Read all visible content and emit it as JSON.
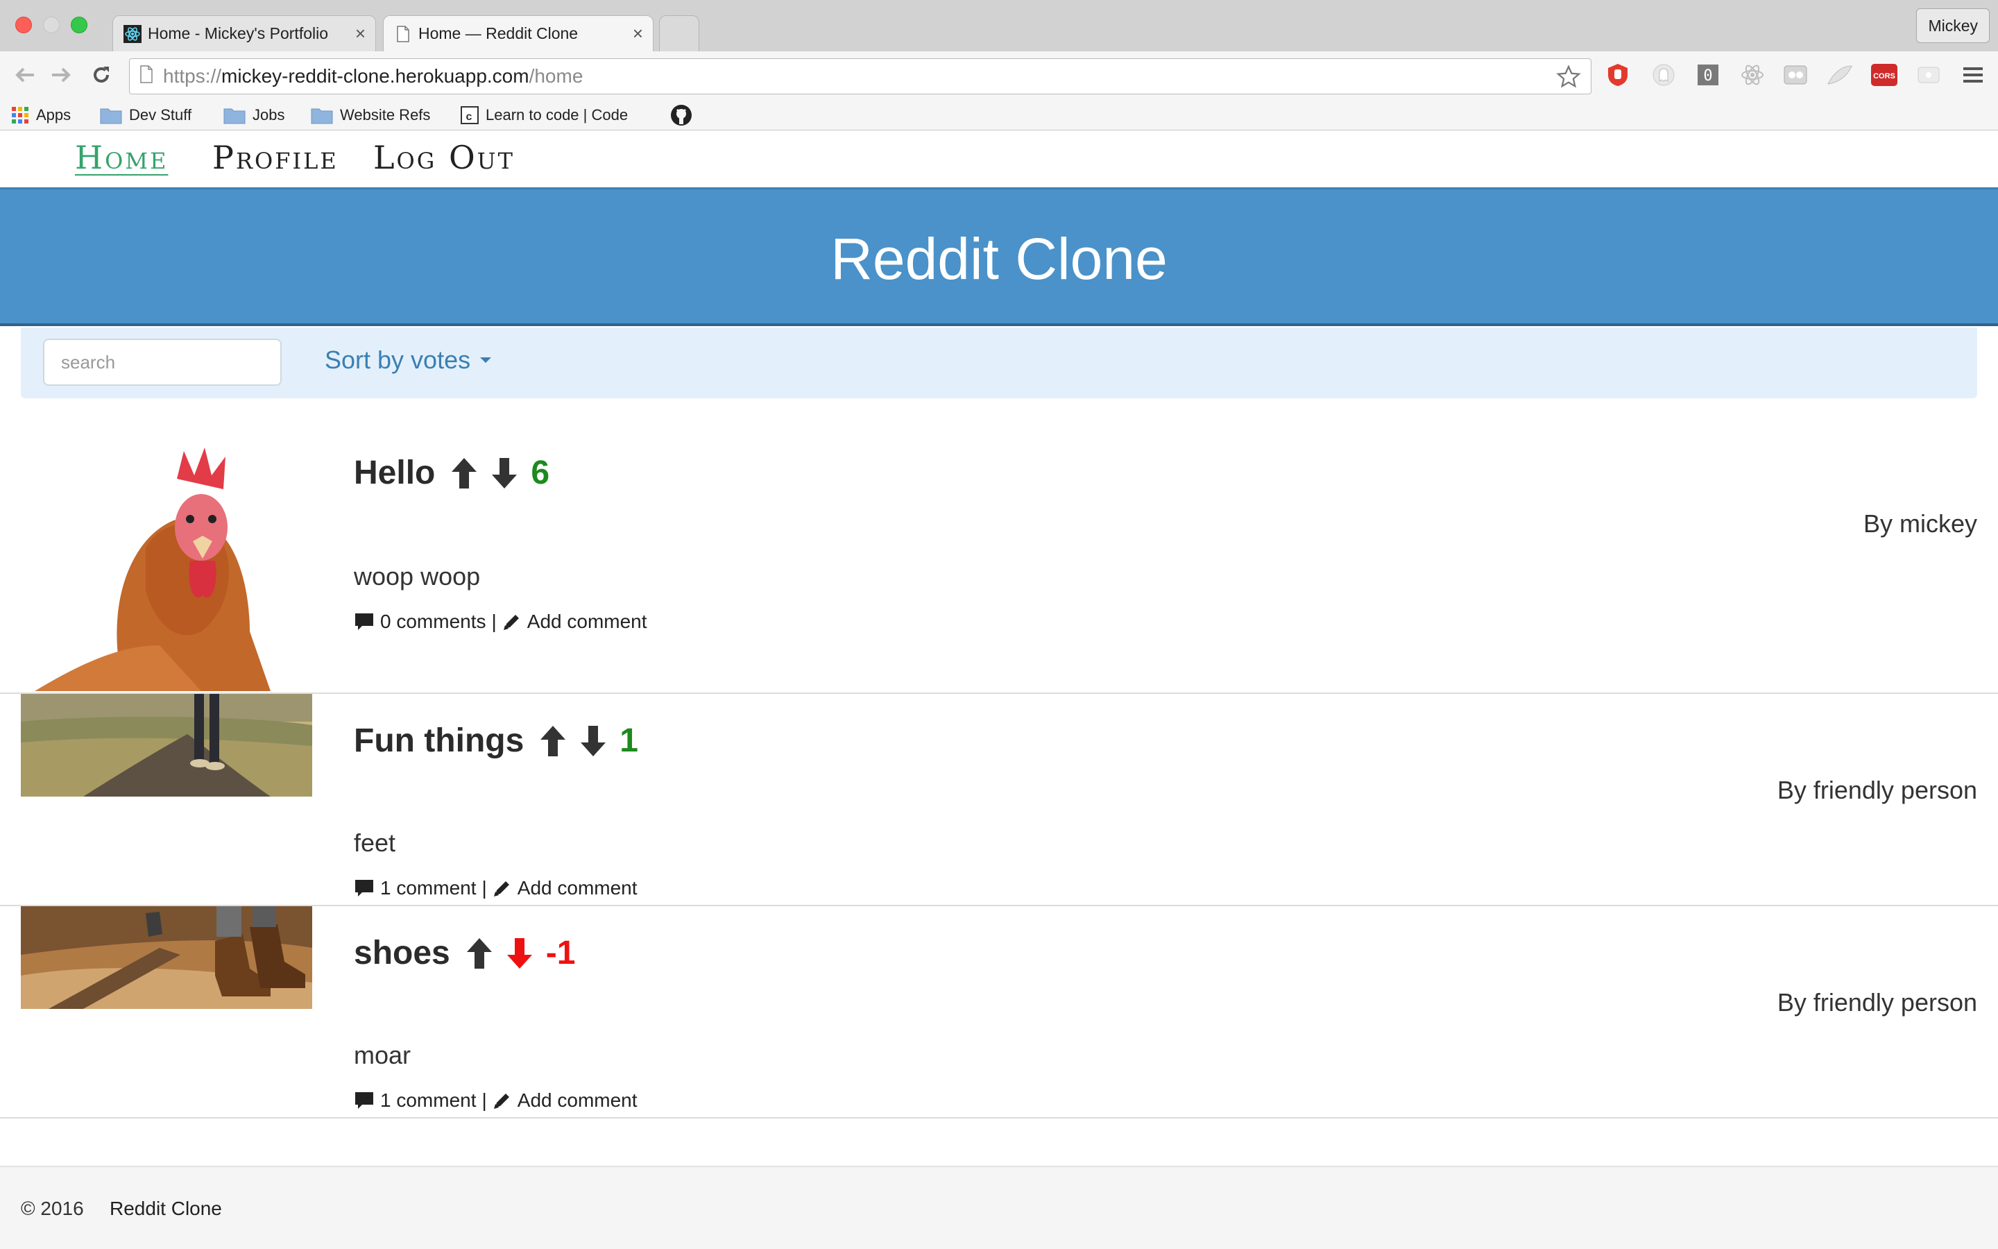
{
  "browser": {
    "tabs": [
      {
        "title": "Home - Mickey's Portfolio",
        "close": "×"
      },
      {
        "title": "Home — Reddit Clone",
        "close": "×"
      }
    ],
    "profile_name": "Mickey",
    "url": {
      "scheme": "https://",
      "host": "mickey-reddit-clone.herokuapp.com",
      "path": "/home"
    },
    "bookmarks": [
      {
        "label": "Apps",
        "icon": "apps-grid-icon"
      },
      {
        "label": "Dev Stuff",
        "icon": "folder-icon"
      },
      {
        "label": "Jobs",
        "icon": "folder-icon"
      },
      {
        "label": "Website Refs",
        "icon": "folder-icon"
      },
      {
        "label": "Learn to code | Code",
        "icon": "codecademy-icon"
      },
      {
        "label": "",
        "icon": "github-icon"
      }
    ],
    "extensions": [
      "ublock-icon",
      "ghostery-icon",
      "zero-icon",
      "react-devtools-icon",
      "extension-icon",
      "feather-icon",
      "cors-icon",
      "extension-icon"
    ],
    "extension_cors_label": "CORS"
  },
  "nav": {
    "items": [
      {
        "label": "Home",
        "active": true
      },
      {
        "label": "Profile",
        "active": false
      },
      {
        "label": "Log Out",
        "active": false
      }
    ]
  },
  "header": {
    "title": "Reddit Clone",
    "color": "#4a92c9"
  },
  "filter": {
    "search_placeholder": "search",
    "sort_label": "Sort by votes"
  },
  "posts": [
    {
      "title": "Hello",
      "score": "6",
      "score_color": "#1d8a1d",
      "vote_state": "none",
      "author": "By mickey",
      "body": "woop woop",
      "comments": "0 comments",
      "separator": "|",
      "add_comment": "Add comment",
      "image": "rooster-photo"
    },
    {
      "title": "Fun things",
      "score": "1",
      "score_color": "#1d8a1d",
      "vote_state": "none",
      "author": "By friendly person",
      "body": "feet",
      "comments": "1 comment",
      "separator": "|",
      "add_comment": "Add comment",
      "image": "walking-road-photo"
    },
    {
      "title": "shoes",
      "score": "-1",
      "score_color": "#ee1111",
      "vote_state": "down",
      "author": "By friendly person",
      "body": "moar",
      "comments": "1 comment",
      "separator": "|",
      "add_comment": "Add comment",
      "image": "hiking-boots-photo"
    }
  ],
  "footer": {
    "copyright": "© 2016",
    "name": "Reddit Clone"
  },
  "colors": {
    "accent_nav": "#34a36c",
    "upvote": "#333333",
    "downvote_active": "#ee1111",
    "filter_bg": "#e3f0fb"
  }
}
